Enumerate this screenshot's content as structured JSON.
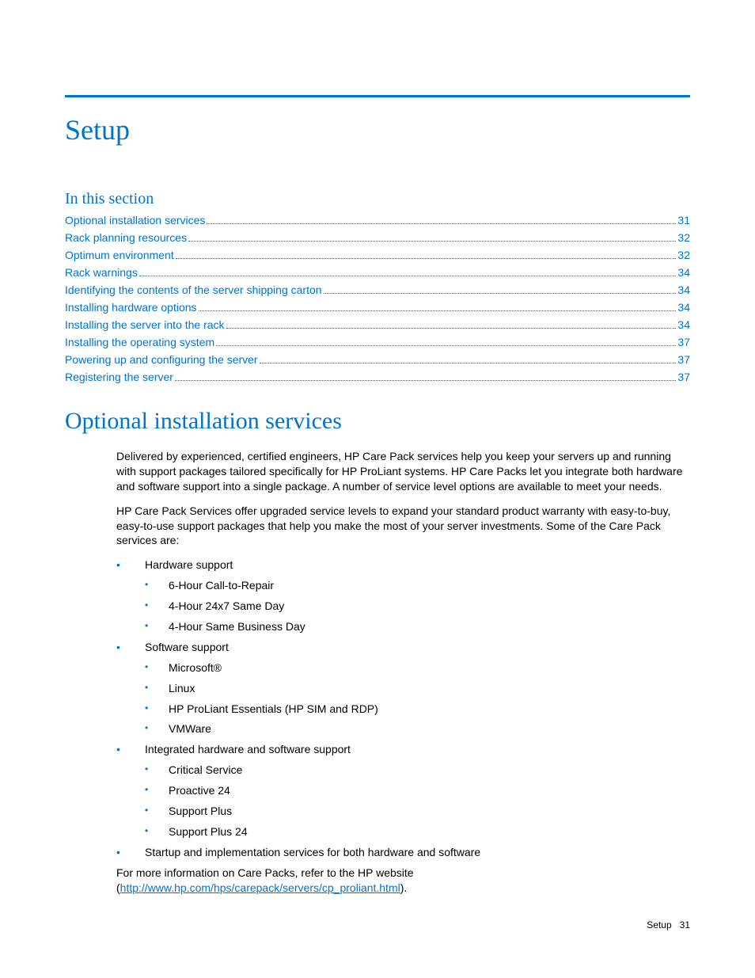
{
  "title": "Setup",
  "section_heading": "In this section",
  "toc": [
    {
      "label": "Optional installation services",
      "page": "31"
    },
    {
      "label": "Rack planning resources",
      "page": "32"
    },
    {
      "label": "Optimum environment",
      "page": "32"
    },
    {
      "label": "Rack warnings",
      "page": "34"
    },
    {
      "label": "Identifying the contents of the server shipping carton",
      "page": "34"
    },
    {
      "label": "Installing hardware options",
      "page": "34"
    },
    {
      "label": "Installing the server into the rack",
      "page": "34"
    },
    {
      "label": "Installing the operating system",
      "page": "37"
    },
    {
      "label": "Powering up and configuring the server",
      "page": "37"
    },
    {
      "label": "Registering the server",
      "page": "37"
    }
  ],
  "h2": "Optional installation services",
  "para1": "Delivered by experienced, certified engineers, HP Care Pack services help you keep your servers up and running with support packages tailored specifically for HP ProLiant systems. HP Care Packs let you integrate both hardware and software support into a single package. A number of service level options are available to meet your needs.",
  "para2": "HP Care Pack Services offer upgraded service levels to expand your standard product warranty with easy-to-buy, easy-to-use support packages that help you make the most of your server investments. Some of the Care Pack services are:",
  "bullets": [
    {
      "label": "Hardware support",
      "children": [
        "6-Hour Call-to-Repair",
        "4-Hour 24x7 Same Day",
        "4-Hour Same Business Day"
      ]
    },
    {
      "label": "Software support",
      "children": [
        "Microsoft®",
        "Linux",
        "HP ProLiant Essentials (HP SIM and RDP)",
        "VMWare"
      ]
    },
    {
      "label": "Integrated hardware and software support",
      "children": [
        "Critical Service",
        "Proactive 24",
        "Support Plus",
        "Support Plus 24"
      ]
    },
    {
      "label": "Startup and implementation services for both hardware and software",
      "children": []
    }
  ],
  "para3_prefix": "For more information on Care Packs, refer to the HP website (",
  "para3_link": "http://www.hp.com/hps/carepack/servers/cp_proliant.html",
  "para3_suffix": ").",
  "footer_section": "Setup",
  "footer_page": "31"
}
